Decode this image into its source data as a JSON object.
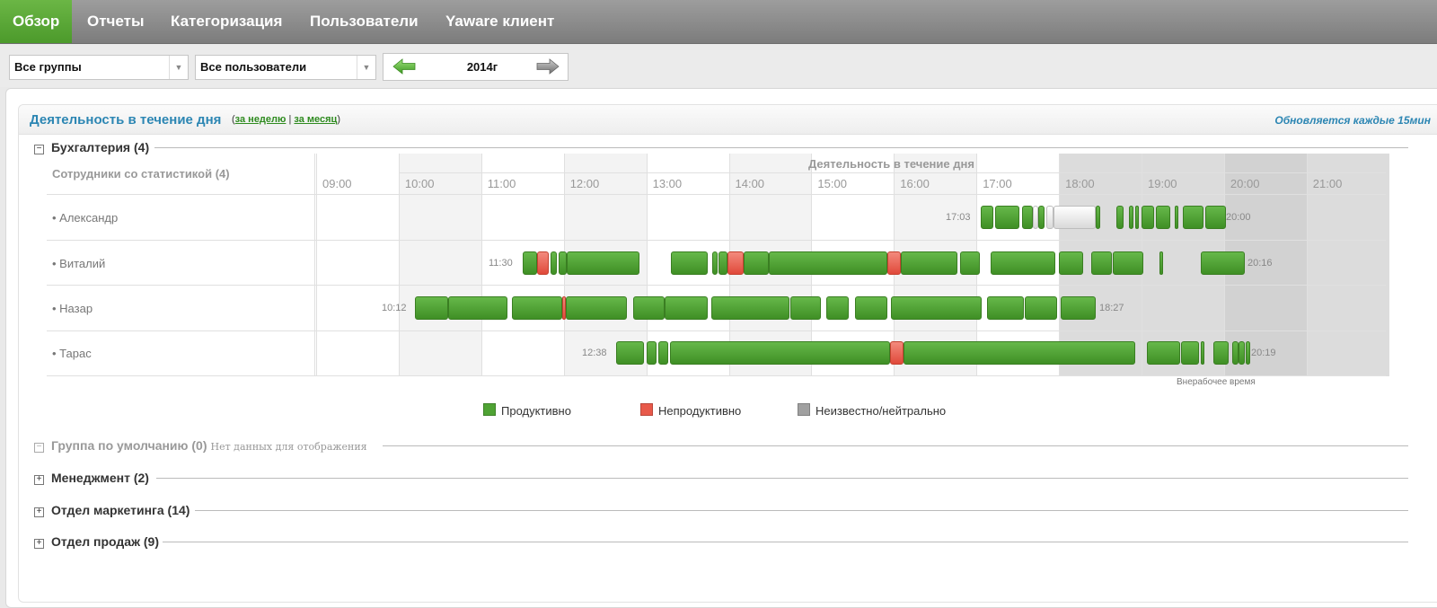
{
  "nav": {
    "items": [
      "Обзор",
      "Отчеты",
      "Категоризация",
      "Пользователи",
      "Yaware клиент"
    ],
    "active_index": 0
  },
  "toolbar": {
    "group_select": "Все группы",
    "user_select": "Все пользователи",
    "year": "2014г"
  },
  "panel": {
    "title": "Деятельность в течение дня",
    "link_open": "(",
    "link_week": "за неделю",
    "link_sep": "|",
    "link_month": "за месяц",
    "link_close": ")",
    "update_note": "Обновляется каждые 15мин"
  },
  "groups": [
    {
      "toggle": "−",
      "label": "Бухгалтерия (4)"
    },
    {
      "toggle": "−",
      "label": "Группа по умолчанию (0)",
      "note": "Нет данных для отображения"
    },
    {
      "toggle": "+",
      "label": "Менеджмент (2)"
    },
    {
      "toggle": "+",
      "label": "Отдел маркетинга (14)"
    },
    {
      "toggle": "+",
      "label": "Отдел продаж (9)"
    }
  ],
  "table": {
    "left_header": "Сотрудники со статистикой (4)",
    "top_header": "Деятельность в течение дня",
    "hours": [
      "09:00",
      "10:00",
      "11:00",
      "12:00",
      "13:00",
      "14:00",
      "15:00",
      "16:00",
      "17:00",
      "18:00",
      "19:00",
      "20:00",
      "21:00"
    ],
    "off_work_label": "Внерабочее время",
    "employees": [
      {
        "name": "• Александр",
        "start": "17:03",
        "end": "20:00"
      },
      {
        "name": "• Виталий",
        "start": "11:30",
        "end": "20:16"
      },
      {
        "name": "• Назар",
        "start": "10:12",
        "end": "18:27"
      },
      {
        "name": "• Тарас",
        "start": "12:38",
        "end": "20:19"
      }
    ]
  },
  "legend": [
    {
      "label": "Продуктивно",
      "color": "#4fa334"
    },
    {
      "label": "Непродуктивно",
      "color": "#e8594a"
    },
    {
      "label": "Неизвестно/нейтрально",
      "color": "#a0a0a0"
    }
  ],
  "colors": {
    "accent_green": "#4c9a2b",
    "title_blue": "#2c86b3"
  }
}
